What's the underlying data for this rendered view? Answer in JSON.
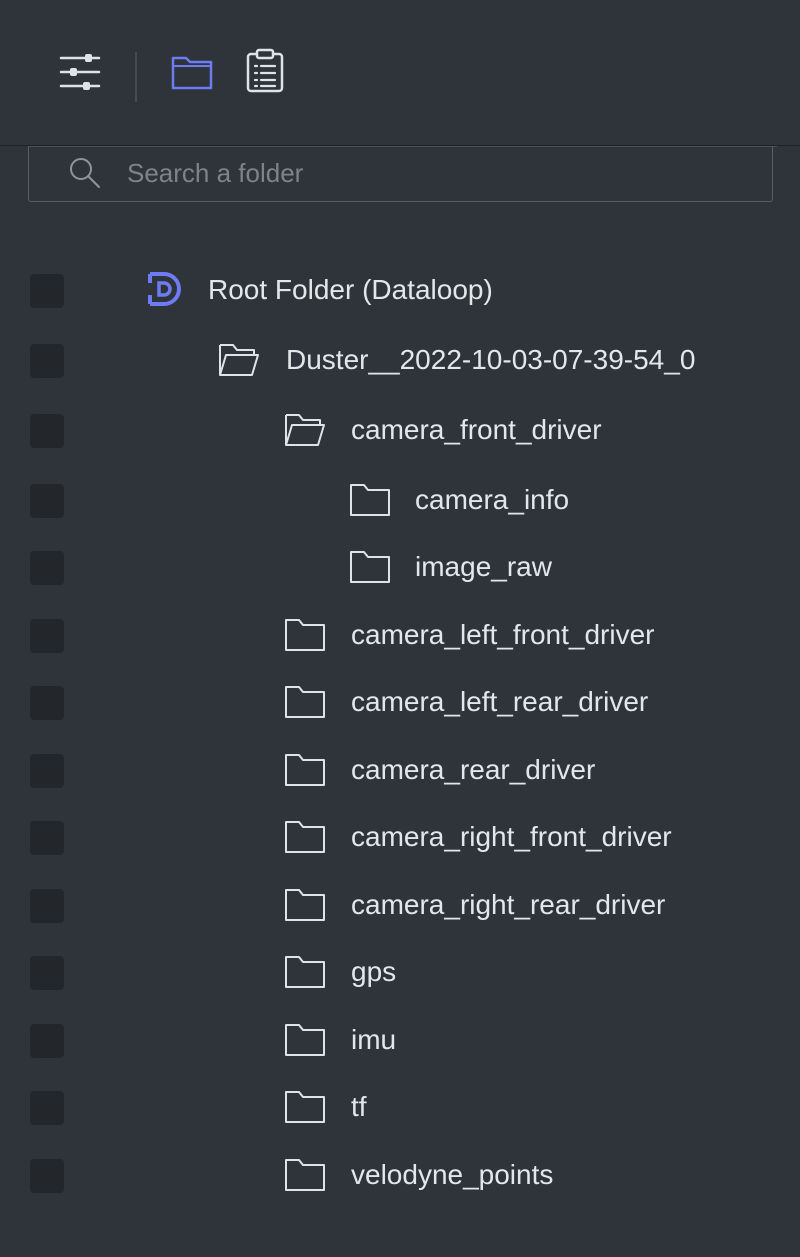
{
  "toolbar": {
    "icons": [
      "sliders-icon",
      "folder-icon",
      "clipboard-list-icon"
    ],
    "active_color": "#6e7bf2"
  },
  "search": {
    "placeholder": "Search a folder"
  },
  "tree": [
    {
      "label": "Root Folder (Dataloop)",
      "icon": "dataloop-logo-icon",
      "depth": 0
    },
    {
      "label": "Duster__2022-10-03-07-39-54_0",
      "icon": "folder-open-icon",
      "depth": 1
    },
    {
      "label": "camera_front_driver",
      "icon": "folder-open-icon",
      "depth": 2
    },
    {
      "label": "camera_info",
      "icon": "folder-icon",
      "depth": 3
    },
    {
      "label": "image_raw",
      "icon": "folder-icon",
      "depth": 3
    },
    {
      "label": "camera_left_front_driver",
      "icon": "folder-icon",
      "depth": 2
    },
    {
      "label": "camera_left_rear_driver",
      "icon": "folder-icon",
      "depth": 2
    },
    {
      "label": "camera_rear_driver",
      "icon": "folder-icon",
      "depth": 2
    },
    {
      "label": "camera_right_front_driver",
      "icon": "folder-icon",
      "depth": 2
    },
    {
      "label": "camera_right_rear_driver",
      "icon": "folder-icon",
      "depth": 2
    },
    {
      "label": "gps",
      "icon": "folder-icon",
      "depth": 2
    },
    {
      "label": "imu",
      "icon": "folder-icon",
      "depth": 2
    },
    {
      "label": "tf",
      "icon": "folder-icon",
      "depth": 2
    },
    {
      "label": "velodyne_points",
      "icon": "folder-icon",
      "depth": 2
    }
  ]
}
